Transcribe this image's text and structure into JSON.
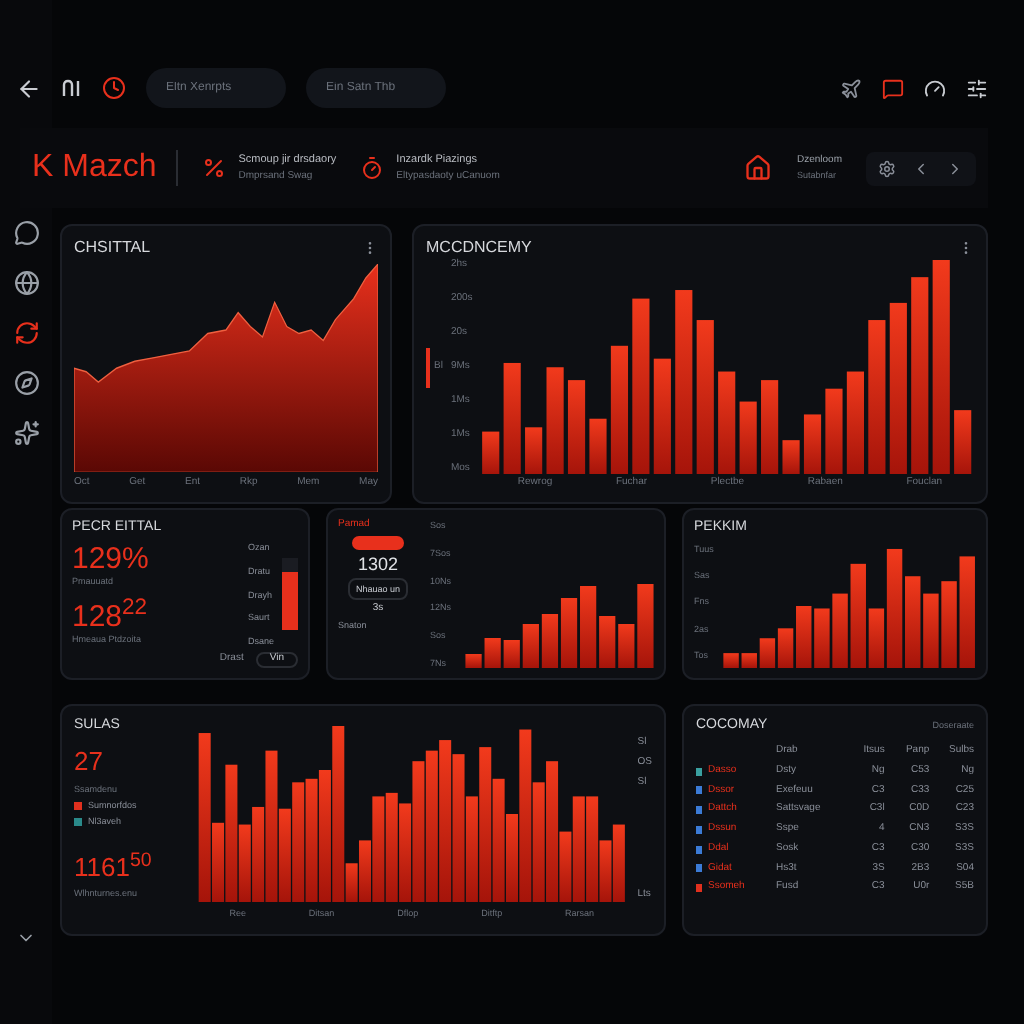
{
  "topbar": {
    "search_fields": [
      {
        "placeholder": "Eltn Xenrpts"
      },
      {
        "placeholder": "Ein Satn Thb"
      }
    ]
  },
  "header": {
    "logo": "K Mazch",
    "items": [
      {
        "title": "Scmoup jir drsdaory",
        "subtitle": "Dmprsand Swag"
      },
      {
        "title": "Inzardk Piazings",
        "subtitle": "Eltypasdaoty uCanuom"
      }
    ],
    "account": {
      "title": "Dzenloom",
      "subtitle": "Sutabnfar"
    }
  },
  "sidebar": {
    "items": [
      {
        "selected": false
      },
      {
        "selected": false
      },
      {
        "selected": true
      },
      {
        "selected": false
      },
      {
        "selected": false
      }
    ]
  },
  "area_card": {
    "title": "CHSITTAL",
    "x_labels": [
      "Oct",
      "Get",
      "Ent",
      "Rkp",
      "Mem",
      "May"
    ]
  },
  "bar_card": {
    "title": "MCCDNCEMY",
    "legend": "Bl",
    "y_labels": [
      "2hs",
      "200s",
      "20s",
      "9Ms",
      "1Ms",
      "1Ms",
      "Mos"
    ],
    "x_labels": [
      "Rewrog",
      "Fuchar",
      "Plectbe",
      "Rabaen",
      "Fouclan"
    ]
  },
  "stat_card": {
    "title": "PECR EITTAL",
    "value_1": "129%",
    "label_1": "Pmauuatd",
    "value_2": "128$^{22}$",
    "label_2": "Hmeaua Ptdzoita",
    "list": [
      "Ozan",
      "Dratu",
      "Drayh",
      "Saurt",
      "Dsane"
    ],
    "level": 0.8,
    "footer_label": "Drast",
    "footer_button": "Vin"
  },
  "mid_card": {
    "badge": "Pamad",
    "value": "1302",
    "button": "Nhauao un",
    "small": "3s",
    "link": "Snaton",
    "y_labels": [
      "Sos",
      "7Sos",
      "10Ns",
      "12Ns",
      "Sos",
      "7Ns"
    ]
  },
  "right_card": {
    "title": "PEKKIM",
    "y_labels": [
      "Tuus",
      "Sas",
      "Fns",
      "2as",
      "Tos"
    ]
  },
  "sales_card": {
    "title": "SULAS",
    "value_1": "27",
    "label_1": "Ssamdenu",
    "legend": [
      {
        "label": "Sumnorfdos",
        "color": "#e0301e"
      },
      {
        "label": "Nl3aveh",
        "color": "#2a8a8a"
      }
    ],
    "value_2": "1161$^{50}$",
    "label_2": "Wlhnturnes.enu",
    "x_labels": [
      "Ree",
      "Ditsan",
      "Dflop",
      "Ditftp",
      "Rarsan"
    ],
    "side_labels": [
      "Sl",
      "OS",
      "Sl"
    ],
    "corner": "Lts"
  },
  "table_card": {
    "title": "COCOMAY",
    "action": "Doseraate",
    "columns": [
      "",
      "Drab",
      "Itsus",
      "Panp",
      "Sulbs"
    ],
    "rows": [
      {
        "color": "#3aa0a0",
        "cells": [
          "Dasso",
          "Dsty",
          "Ng",
          "C53",
          "Ng"
        ]
      },
      {
        "color": "#3b7bd6",
        "cells": [
          "Dssor",
          "Exefeuu",
          "C3",
          "C33",
          "C25"
        ]
      },
      {
        "color": "#3b7bd6",
        "cells": [
          "Dattch",
          "Sattsvage",
          "C3l",
          "C0D",
          "C23"
        ]
      },
      {
        "color": "#3b7bd6",
        "cells": [
          "Dssun",
          "Sspe",
          "4",
          "CN3",
          "S3S"
        ]
      },
      {
        "color": "#3b7bd6",
        "cells": [
          "Ddal",
          "Sosk",
          "C3",
          "C30",
          "S3S"
        ]
      },
      {
        "color": "#3b7bd6",
        "cells": [
          "Gidat",
          "Hs3t",
          "3S",
          "2B3",
          "S04"
        ]
      },
      {
        "color": "#e0301e",
        "cells": [
          "Ssomeh",
          "Fusd",
          "C3",
          "U0r",
          "S5B"
        ]
      }
    ]
  }
}
